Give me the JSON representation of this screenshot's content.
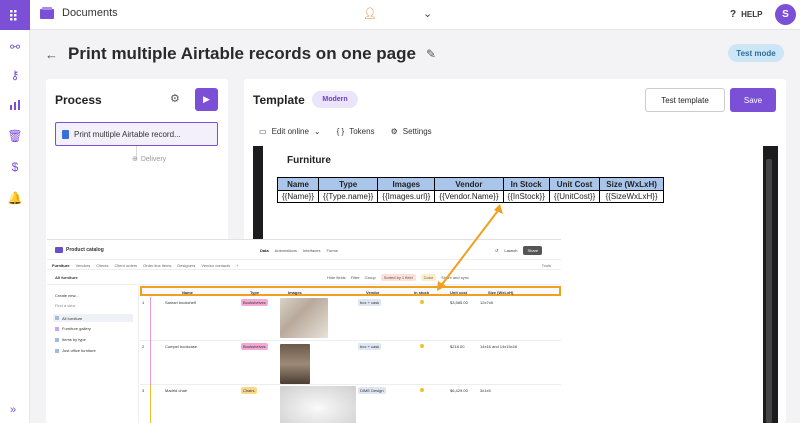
{
  "topbar": {
    "app_title": "Documents",
    "help_label": "HELP",
    "avatar_initial": "S"
  },
  "header": {
    "title": "Print multiple Airtable records on one page",
    "mode_badge": "Test mode"
  },
  "process": {
    "title": "Process",
    "item_label": "Print multiple Airtable record...",
    "delivery_label": "Delivery"
  },
  "template": {
    "title": "Template",
    "style_badge": "Modern",
    "test_button": "Test template",
    "save_button": "Save",
    "tools": {
      "edit_online": "Edit online",
      "tokens": "Tokens",
      "settings": "Settings"
    },
    "doc": {
      "heading": "Furniture",
      "headers": [
        "Name",
        "Type",
        "Images",
        "Vendor",
        "In Stock",
        "Unit Cost",
        "Size (WxLxH)"
      ],
      "row": [
        "{{Name}}",
        "{{Type.name}}",
        "{{Images.url}}",
        "{{Vendor.Name}}",
        "{{InStock}}",
        "{{UnitCost}}",
        "{{SizeWxLxH}}"
      ]
    }
  },
  "airtable": {
    "base_name": "Product catalog",
    "top_tabs": [
      "Data",
      "Automations",
      "Interfaces",
      "Forms"
    ],
    "launch": "Launch",
    "share": "Share",
    "table_tabs": [
      "Furniture",
      "Vendors",
      "Clients",
      "Client orders",
      "Order line items",
      "Designers",
      "Vendor contacts",
      "+"
    ],
    "tools_label": "Tools",
    "view_name": "All furniture",
    "view_tools": [
      "Hide fields",
      "Filter",
      "Group",
      "Sorted by 1 field",
      "Color",
      "Share and sync"
    ],
    "sidebar": [
      "Create new...",
      "Find a view",
      "All furniture",
      "Furniture gallery",
      "Items by type",
      "Just office furniture"
    ],
    "columns": [
      "Name",
      "Type",
      "Images",
      "Vendor",
      "In stock",
      "Unit cost",
      "Size (WxLxH)"
    ],
    "rows": [
      {
        "num": "1",
        "name": "Samari bookshelf",
        "type": "Bookshelves",
        "vendor": "box + cask",
        "cost": "$3,585.00",
        "size": "12x7x8"
      },
      {
        "num": "2",
        "name": "Compel bookcase",
        "type": "Bookshelves",
        "vendor": "box + cask",
        "cost": "$218.00",
        "size": "14x16 and 14x15x16"
      },
      {
        "num": "3",
        "name": "Madrid chair",
        "type": "Chairs",
        "vendor": "DIME Design",
        "cost": "$6,429.00",
        "size": "3x1x5"
      }
    ]
  },
  "colors": {
    "accent": "#7b4fd6",
    "highlight": "#f0a01e",
    "table_header": "#a9c6ea",
    "badge_test": "#cde6f6"
  }
}
